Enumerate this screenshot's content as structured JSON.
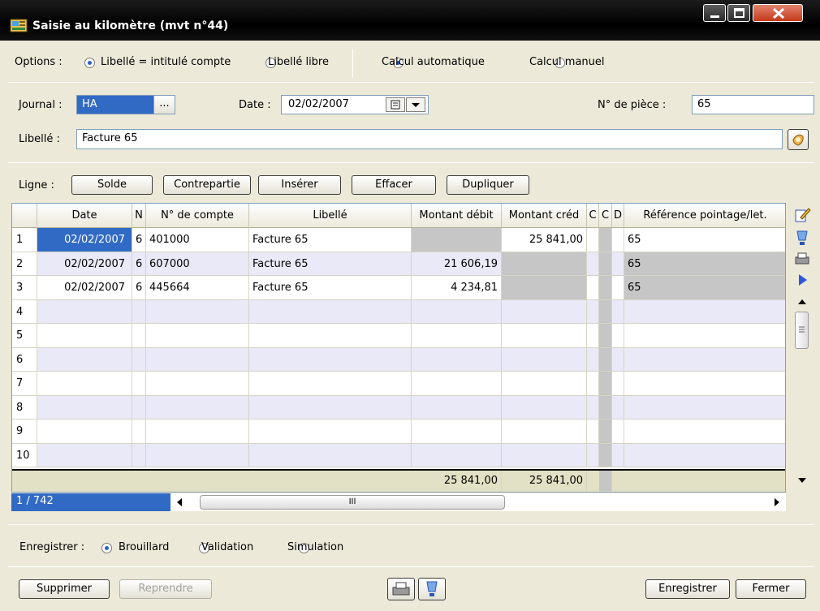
{
  "window": {
    "title": "Saisie au kilomètre (mvt n°44)"
  },
  "options": {
    "label": "Options :",
    "libelle_intitule": "Libellé = intitulé compte",
    "libelle_libre": "Libellé libre",
    "calcul_auto": "Calcul automatique",
    "calcul_manuel": "Calcul manuel"
  },
  "form": {
    "journal_label": "Journal :",
    "journal_value": "HA",
    "journal_browse": "...",
    "date_label": "Date :",
    "date_value": "02/02/2007",
    "piece_label": "N° de pièce :",
    "piece_value": "65",
    "libelle_label": "Libellé :",
    "libelle_value": "Facture 65"
  },
  "ligne": {
    "label": "Ligne :",
    "solde": "Solde",
    "contrepartie": "Contrepartie",
    "inserer": "Insérer",
    "effacer": "Effacer",
    "dupliquer": "Dupliquer"
  },
  "grid": {
    "columns": [
      "Date",
      "N",
      "N° de compte",
      "Libellé",
      "Montant débit",
      "Montant créd",
      "C",
      "C",
      "D",
      "Référence pointage/let."
    ],
    "rows": [
      {
        "num": "1",
        "date": "02/02/2007",
        "n": "6",
        "compte": "401000",
        "libelle": "Facture 65",
        "debit": "",
        "credit": "25 841,00",
        "ref": "65"
      },
      {
        "num": "2",
        "date": "02/02/2007",
        "n": "6",
        "compte": "607000",
        "libelle": "Facture 65",
        "debit": "21 606,19",
        "credit": "",
        "ref": "65"
      },
      {
        "num": "3",
        "date": "02/02/2007",
        "n": "6",
        "compte": "445664",
        "libelle": "Facture 65",
        "debit": "4 234,81",
        "credit": "",
        "ref": "65"
      },
      {
        "num": "4",
        "date": "",
        "n": "",
        "compte": "",
        "libelle": "",
        "debit": "",
        "credit": "",
        "ref": ""
      },
      {
        "num": "5",
        "date": "",
        "n": "",
        "compte": "",
        "libelle": "",
        "debit": "",
        "credit": "",
        "ref": ""
      },
      {
        "num": "6",
        "date": "",
        "n": "",
        "compte": "",
        "libelle": "",
        "debit": "",
        "credit": "",
        "ref": ""
      },
      {
        "num": "7",
        "date": "",
        "n": "",
        "compte": "",
        "libelle": "",
        "debit": "",
        "credit": "",
        "ref": ""
      },
      {
        "num": "8",
        "date": "",
        "n": "",
        "compte": "",
        "libelle": "",
        "debit": "",
        "credit": "",
        "ref": ""
      },
      {
        "num": "9",
        "date": "",
        "n": "",
        "compte": "",
        "libelle": "",
        "debit": "",
        "credit": "",
        "ref": ""
      },
      {
        "num": "10",
        "date": "",
        "n": "",
        "compte": "",
        "libelle": "",
        "debit": "",
        "credit": "",
        "ref": ""
      }
    ],
    "total_debit": "25 841,00",
    "total_credit": "25 841,00",
    "position": "1 / 742",
    "hscroll_grip": "III"
  },
  "enregistrer": {
    "label": "Enregistrer :",
    "brouillard": "Brouillard",
    "validation": "Validation",
    "simulation": "Simulation"
  },
  "footer": {
    "supprimer": "Supprimer",
    "reprendre": "Reprendre",
    "enregistrer": "Enregistrer",
    "fermer": "Fermer"
  },
  "colors": {
    "selection": "#316ac5",
    "alt_row": "#e9e9f8",
    "total_row": "#e3e1c5",
    "shaded": "#c6c6c6"
  }
}
